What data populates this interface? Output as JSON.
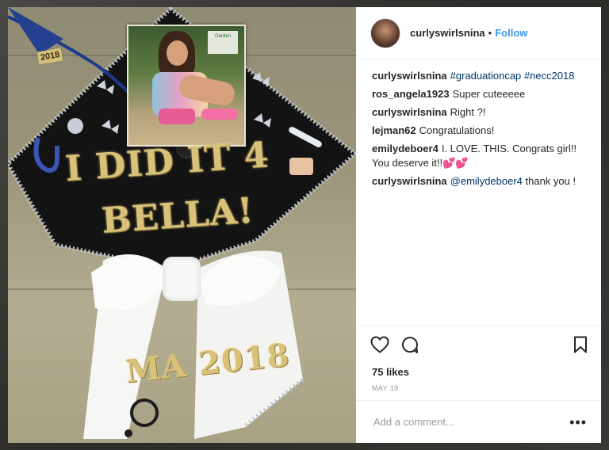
{
  "post": {
    "username": "curlyswirlsnina",
    "separator": "•",
    "follow_label": "Follow",
    "likes": "75 likes",
    "date": "MAY 19",
    "comment_placeholder": "Add a comment...",
    "more_label": "•••"
  },
  "photo": {
    "cap_line1": "I DID IT 4",
    "cap_line2": "BELLA!",
    "ribbon_text": "MA 2018",
    "tassel_year": "2018",
    "sign_text": "Garden"
  },
  "comments": [
    {
      "user": "curlyswirlsnina",
      "text": "",
      "tag": "#graduationcap #necc2018",
      "after": ""
    },
    {
      "user": "ros_angela1923",
      "text": "Super cuteeeee",
      "tag": "",
      "after": ""
    },
    {
      "user": "curlyswirlsnina",
      "text": "Right ?!",
      "tag": "",
      "after": ""
    },
    {
      "user": "lejman62",
      "text": "Congratulations!",
      "tag": "",
      "after": ""
    },
    {
      "user": "emilydeboer4",
      "text": "I. LOVE. THIS. Congrats girl!! You deserve it!!💕💕",
      "tag": "",
      "after": ""
    },
    {
      "user": "curlyswirlsnina",
      "text": "",
      "tag": "@emilydeboer4",
      "after": " thank you !"
    }
  ],
  "icons": {
    "like": "heart-icon",
    "comment": "comment-bubble-icon",
    "save": "bookmark-icon"
  },
  "colors": {
    "follow": "#3897f0",
    "hashtag": "#003569",
    "text": "#262626",
    "muted": "#999999",
    "cap_gold": "#d8c27a"
  }
}
